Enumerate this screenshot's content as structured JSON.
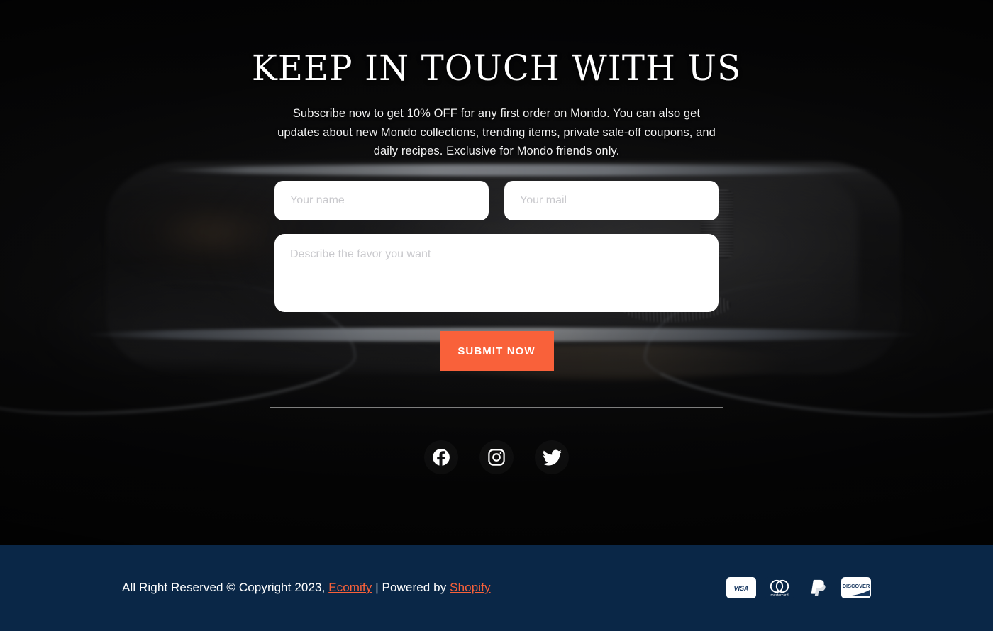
{
  "section": {
    "headline": "Keep In Touch With Us",
    "subtext": "Subscribe now to get 10% OFF for any first order on Mondo. You can also get updates about new Mondo collections, trending items, private sale-off coupons, and daily recipes. Exclusive for Mondo friends only."
  },
  "form": {
    "name_placeholder": "Your name",
    "name_value": "",
    "mail_placeholder": "Your mail",
    "mail_value": "",
    "message_placeholder": "Describe the favor you want",
    "message_value": "",
    "submit_label": "Submit Now"
  },
  "socials": [
    {
      "name": "facebook",
      "icon": "facebook-icon"
    },
    {
      "name": "instagram",
      "icon": "instagram-icon"
    },
    {
      "name": "twitter",
      "icon": "twitter-icon"
    }
  ],
  "footer": {
    "copyright_prefix": "All Right Reserved © Copyright 2023,",
    "brand_link": "Ecomify",
    "separator": "| Powered by",
    "platform_link": "Shopify",
    "payments": [
      {
        "name": "visa",
        "label": "VISA"
      },
      {
        "name": "mastercard",
        "label": "mastercard"
      },
      {
        "name": "paypal",
        "label": "PayPal"
      },
      {
        "name": "discover",
        "label": "DISCOVER"
      }
    ]
  },
  "colors": {
    "accent": "#f9613a",
    "footer_bg": "#0a2747",
    "field_bg": "#ffffff",
    "placeholder": "#c9c9cd",
    "text_light": "#ffffff"
  }
}
